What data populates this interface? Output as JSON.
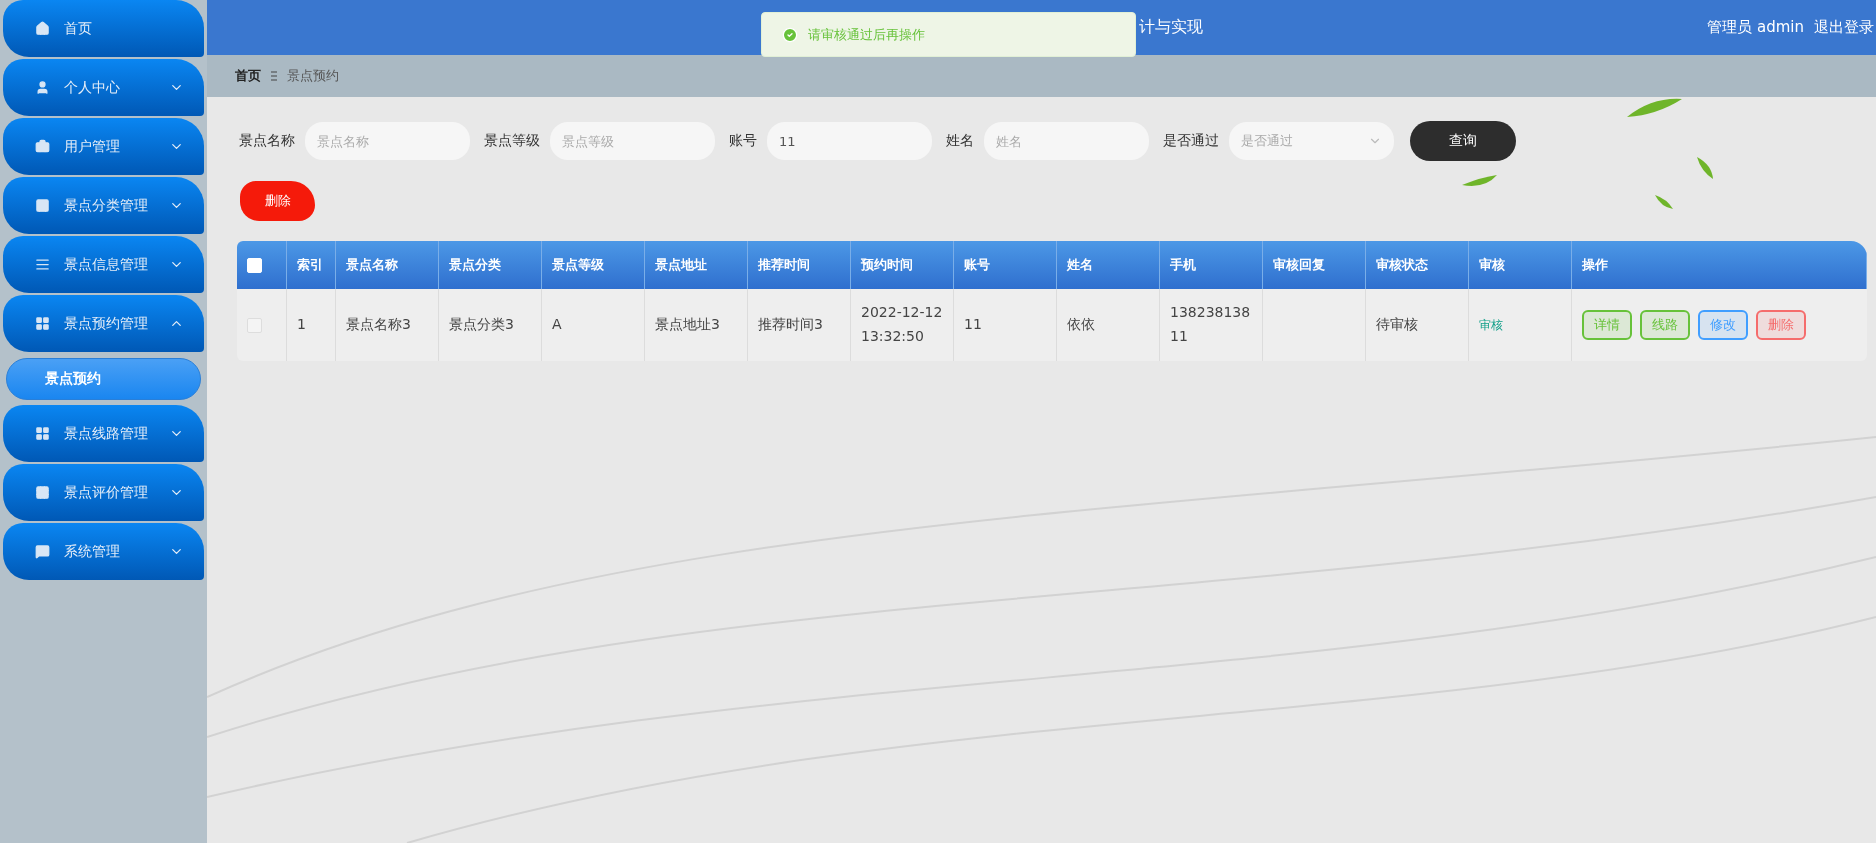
{
  "header": {
    "title": "计与实现",
    "user": "管理员 admin",
    "logout": "退出登录"
  },
  "toast": {
    "kind": "success",
    "message": "请审核通过后再操作"
  },
  "sidebar": {
    "items": [
      {
        "label": "首页"
      },
      {
        "label": "个人中心",
        "expanded": false
      },
      {
        "label": "用户管理",
        "expanded": false
      },
      {
        "label": "景点分类管理",
        "expanded": false
      },
      {
        "label": "景点信息管理",
        "expanded": false
      },
      {
        "label": "景点预约管理",
        "expanded": true,
        "children": [
          {
            "label": "景点预约",
            "selected": true
          }
        ]
      },
      {
        "label": "景点线路管理",
        "expanded": false
      },
      {
        "label": "景点评价管理",
        "expanded": false
      },
      {
        "label": "系统管理",
        "expanded": false
      }
    ]
  },
  "breadcrumb": [
    "首页",
    "景点预约"
  ],
  "filters": [
    {
      "kind": "text",
      "label": "景点名称",
      "placeholder": "景点名称"
    },
    {
      "kind": "text",
      "label": "景点等级",
      "placeholder": "景点等级"
    },
    {
      "kind": "text",
      "label": "账号",
      "value": "11"
    },
    {
      "kind": "text",
      "label": "姓名",
      "placeholder": "姓名"
    },
    {
      "kind": "select",
      "label": "是否通过",
      "placeholder": "是否通过"
    }
  ],
  "query_button": "查询",
  "delete_button": "删除",
  "table": {
    "select_all_checked": false,
    "columns": [
      "索引",
      "景点名称",
      "景点分类",
      "景点等级",
      "景点地址",
      "推荐时间",
      "预约时间",
      "账号",
      "姓名",
      "手机",
      "审核回复",
      "审核状态",
      "审核",
      "操作"
    ],
    "rows": [
      {
        "checked": false,
        "cells": [
          "1",
          "景点名称3",
          "景点分类3",
          "A",
          "景点地址3",
          "推荐时间3",
          "2022-12-12 13:32:50",
          "11",
          "依依",
          "13823813811",
          null,
          "待审核"
        ],
        "audit_link": "审核",
        "actions": [
          {
            "label": "详情",
            "color": "#67c23a"
          },
          {
            "label": "线路",
            "color": "#67c23a"
          },
          {
            "label": "修改",
            "color": "#409eff"
          },
          {
            "label": "删除",
            "color": "#f56c6c"
          }
        ]
      }
    ]
  }
}
